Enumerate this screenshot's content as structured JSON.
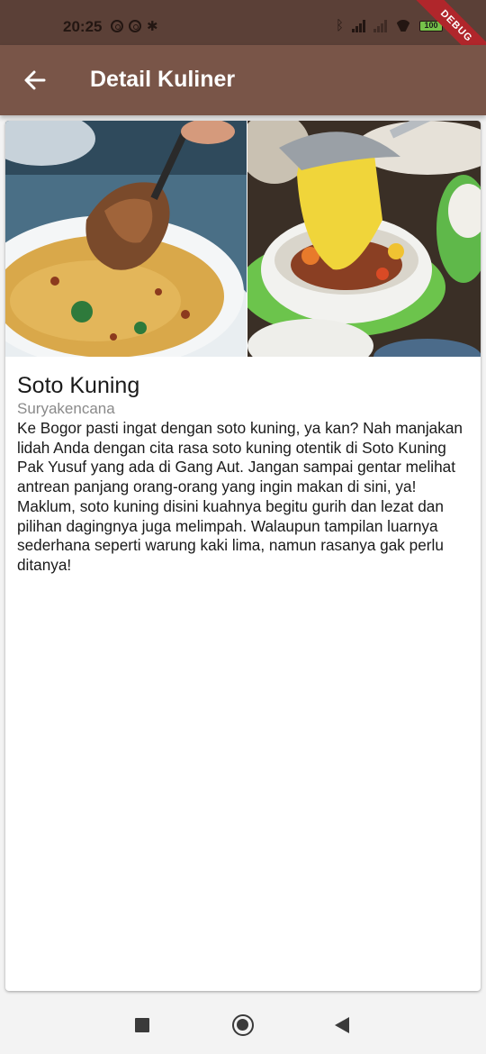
{
  "status_bar": {
    "time": "20:25",
    "left_icons": [
      "notification-icon",
      "notification-icon",
      "settings-icon"
    ],
    "right_icons": [
      "bluetooth-icon",
      "signal-icon",
      "signal-icon",
      "wifi-icon",
      "battery-icon"
    ],
    "battery": "100",
    "debug_banner": "DEBUG"
  },
  "app_bar": {
    "back_icon": "arrow-back-icon",
    "title": "Detail Kuliner",
    "color": "#795548"
  },
  "detail": {
    "images": [
      "soto-kuning-bowl-photo",
      "soto-kuning-pouring-photo"
    ],
    "name": "Soto Kuning",
    "location": "Suryakencana",
    "description": "Ke Bogor pasti ingat dengan soto kuning, ya kan? Nah manjakan lidah Anda dengan cita rasa soto kuning otentik di Soto Kuning Pak Yusuf yang ada di Gang Aut. Jangan sampai gentar melihat antrean panjang orang-orang yang ingin makan di sini, ya! Maklum, soto kuning disini kuahnya begitu gurih dan lezat dan pilihan dagingnya juga melimpah. Walaupun tampilan luarnya sederhana seperti warung kaki lima, namun rasanya gak perlu ditanya!"
  },
  "nav_bar": {
    "icons": [
      "recents-icon",
      "home-icon",
      "back-icon"
    ]
  }
}
